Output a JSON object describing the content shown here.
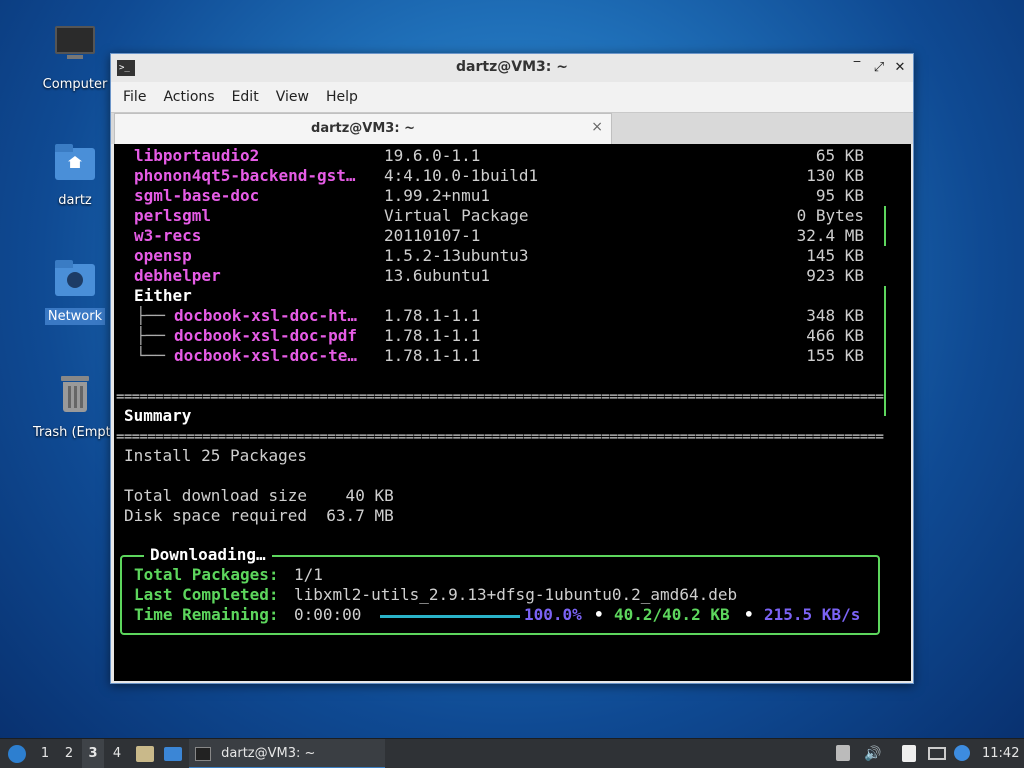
{
  "desktop": {
    "icons": [
      {
        "label": "Computer"
      },
      {
        "label": "dartz"
      },
      {
        "label": "Network"
      },
      {
        "label": "Trash (Empty)"
      }
    ]
  },
  "window": {
    "title": "dartz@VM3: ~",
    "menu": [
      "File",
      "Actions",
      "Edit",
      "View",
      "Help"
    ],
    "tab_title": "dartz@VM3: ~",
    "tab_close": "×"
  },
  "terminal": {
    "packages": [
      {
        "name": "libportaudio2",
        "version": "19.6.0-1.1",
        "size": "65 KB"
      },
      {
        "name": "phonon4qt5-backend-gst…",
        "version": "4:4.10.0-1build1",
        "size": "130 KB"
      },
      {
        "name": "sgml-base-doc",
        "version": "1.99.2+nmu1",
        "size": "95 KB"
      },
      {
        "name": "perlsgml",
        "version": "Virtual Package",
        "size": "0 Bytes"
      },
      {
        "name": "w3-recs",
        "version": "20110107-1",
        "size": "32.4 MB"
      },
      {
        "name": "opensp",
        "version": "1.5.2-13ubuntu3",
        "size": "145 KB"
      },
      {
        "name": "debhelper",
        "version": "13.6ubuntu1",
        "size": "923 KB"
      }
    ],
    "either_label": "Either",
    "either": [
      {
        "tree": "├──",
        "name": "docbook-xsl-doc-ht…",
        "version": "1.78.1-1.1",
        "size": "348 KB"
      },
      {
        "tree": "├──",
        "name": "docbook-xsl-doc-pdf",
        "version": "1.78.1-1.1",
        "size": "466 KB"
      },
      {
        "tree": "└──",
        "name": "docbook-xsl-doc-te…",
        "version": "1.78.1-1.1",
        "size": "155 KB"
      }
    ],
    "rule": "==========================================================================================================",
    "summary_title": "Summary",
    "install_line": "Install 25 Packages",
    "download_line": "Total download size    40 KB",
    "disk_line": "Disk space required  63.7 MB",
    "downloading": {
      "title": "Downloading…",
      "total_label": "Total Packages:",
      "total_value": "1/1",
      "last_label": "Last Completed:",
      "last_value": "libxml2-utils_2.9.13+dfsg-1ubuntu0.2_amd64.deb",
      "time_label": "Time Remaining:",
      "time_value": "0:00:00",
      "progress_fraction": 1.0,
      "percent": "100.0%",
      "bullet": "•",
      "bytes": "40.2/40.2 KB",
      "speed": "215.5 KB/s"
    }
  },
  "taskbar": {
    "workspaces": [
      "1",
      "2",
      "3",
      "4"
    ],
    "active_workspace": "3",
    "task_title": "dartz@VM3: ~",
    "clock": "11:42"
  },
  "colors": {
    "pkg_name": "#e65ce6",
    "accent_green": "#5dd65d",
    "percent": "#7b63f5",
    "progress": "#2ab3c9"
  }
}
